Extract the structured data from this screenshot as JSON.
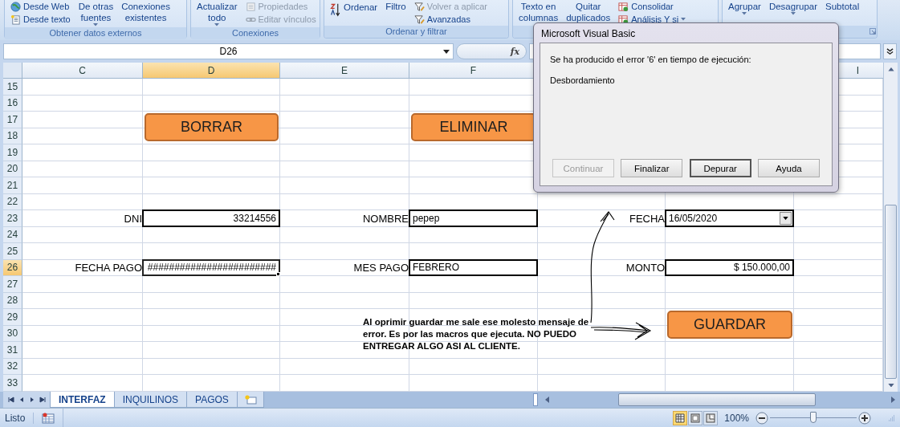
{
  "ribbon": {
    "groups": [
      {
        "label": "Obtener datos externos",
        "controls": [
          {
            "kind": "stack",
            "items": [
              {
                "label": "Desde Web",
                "disabled": false
              },
              {
                "label": "Desde texto",
                "disabled": false
              }
            ]
          },
          {
            "kind": "large",
            "lines": [
              "De otras",
              "fuentes"
            ],
            "dropdown": true
          },
          {
            "kind": "large",
            "lines": [
              "Conexiones",
              "existentes"
            ]
          }
        ]
      },
      {
        "label": "Conexiones",
        "controls": [
          {
            "kind": "large",
            "lines": [
              "Actualizar",
              "todo"
            ],
            "dropdown": true
          },
          {
            "kind": "stack",
            "items": [
              {
                "label": "Propiedades",
                "disabled": true
              },
              {
                "label": "Editar vínculos",
                "disabled": true
              }
            ]
          }
        ]
      },
      {
        "label": "Ordenar y filtrar",
        "controls": [
          {
            "kind": "sort",
            "lines": [
              "Ordenar"
            ]
          },
          {
            "kind": "large",
            "lines": [
              "Filtro"
            ]
          },
          {
            "kind": "stack",
            "items": [
              {
                "label": "Volver a aplicar",
                "disabled": true
              },
              {
                "label": "Avanzadas",
                "disabled": false
              }
            ]
          }
        ]
      },
      {
        "controls": [
          {
            "kind": "large",
            "lines": [
              "Texto en",
              "columnas"
            ]
          },
          {
            "kind": "large",
            "lines": [
              "Quitar",
              "duplicados"
            ]
          },
          {
            "kind": "stack",
            "items": [
              {
                "label": "Consolidar",
                "disabled": false
              },
              {
                "label": "Análisis Y si",
                "disabled": false,
                "dropdown": true
              }
            ]
          }
        ]
      },
      {
        "controls": [
          {
            "kind": "large",
            "lines": [
              "Agrupar"
            ],
            "dropdown": true
          },
          {
            "kind": "large",
            "lines": [
              "Desagrupar"
            ],
            "dropdown": true
          },
          {
            "kind": "large",
            "lines": [
              "Subtotal"
            ]
          }
        ]
      }
    ]
  },
  "formula_bar": {
    "name_box": "D26",
    "function_label": "fx"
  },
  "sheet": {
    "columns": [
      {
        "label": "C",
        "selected": false
      },
      {
        "label": "D",
        "selected": true
      },
      {
        "label": "E",
        "selected": false
      },
      {
        "label": "F",
        "selected": false
      },
      {
        "label": "I",
        "selected": false
      }
    ],
    "rows": [
      {
        "label": "15",
        "selected": false
      },
      {
        "label": "16",
        "selected": false
      },
      {
        "label": "17",
        "selected": false
      },
      {
        "label": "18",
        "selected": false
      },
      {
        "label": "19",
        "selected": false
      },
      {
        "label": "20",
        "selected": false
      },
      {
        "label": "21",
        "selected": false
      },
      {
        "label": "22",
        "selected": false
      },
      {
        "label": "23",
        "selected": false
      },
      {
        "label": "24",
        "selected": false
      },
      {
        "label": "25",
        "selected": false
      },
      {
        "label": "26",
        "selected": true
      },
      {
        "label": "27",
        "selected": false
      },
      {
        "label": "28",
        "selected": false
      },
      {
        "label": "29",
        "selected": false
      },
      {
        "label": "30",
        "selected": false
      },
      {
        "label": "31",
        "selected": false
      },
      {
        "label": "32",
        "selected": false
      },
      {
        "label": "33",
        "selected": false
      }
    ],
    "buttons": [
      {
        "label": "BORRAR"
      },
      {
        "label": "ELIMINAR"
      },
      {
        "label": "GUARDAR"
      }
    ],
    "form": [
      [
        {
          "label": "DNI",
          "value": "33214556",
          "kind": "number",
          "selected": false
        },
        {
          "label": "NOMBRE",
          "value": "pepep",
          "kind": "text",
          "selected": false
        },
        {
          "label": "FECHA",
          "value": "16/05/2020",
          "kind": "text",
          "selected": false,
          "dropdown": true
        }
      ],
      [
        {
          "label": "FECHA PAGO",
          "value": "########################",
          "kind": "number",
          "selected": true
        },
        {
          "label": "MES PAGO",
          "value": "FEBRERO",
          "kind": "text",
          "selected": false
        },
        {
          "label": "MONTO",
          "value": "$ 150.000,00",
          "kind": "number",
          "selected": false
        }
      ]
    ],
    "note": "Al oprimir guardar me sale ese molesto mensaje de error. Es por las macros que ejecuta. NO PUEDO ENTREGAR ALGO ASI AL CLIENTE."
  },
  "dialog": {
    "title": "Microsoft Visual Basic",
    "message": "Se ha producido el error '6' en tiempo de ejecución:",
    "detail": "Desbordamiento",
    "buttons": [
      {
        "label": "Continuar",
        "disabled": true,
        "focused": false
      },
      {
        "label": "Finalizar",
        "disabled": false,
        "focused": false
      },
      {
        "label": "Depurar",
        "disabled": false,
        "focused": true
      },
      {
        "label": "Ayuda",
        "disabled": false,
        "focused": false
      }
    ]
  },
  "sheet_tabs": [
    {
      "label": "INTERFAZ",
      "selected": true
    },
    {
      "label": "INQUILINOS",
      "selected": false
    },
    {
      "label": "PAGOS",
      "selected": false
    }
  ],
  "status_bar": {
    "status": "Listo",
    "views": [
      {
        "selected": true
      },
      {
        "selected": false
      },
      {
        "selected": false
      }
    ],
    "zoom": "100%",
    "zoom_slider": {
      "level": 0.5
    }
  }
}
